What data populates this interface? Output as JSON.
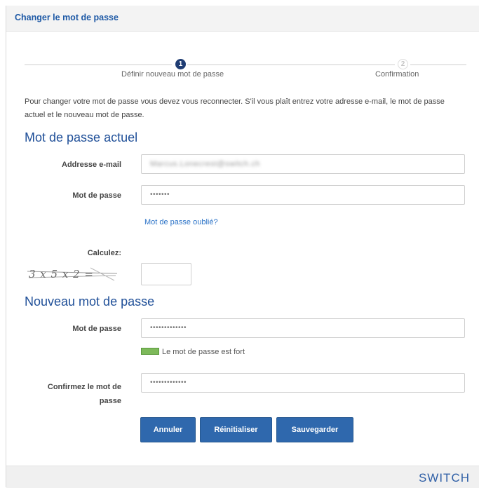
{
  "header": {
    "title": "Changer le mot de passe"
  },
  "steps": [
    {
      "number": "1",
      "label": "Définir nouveau mot de passe",
      "active": true
    },
    {
      "number": "2",
      "label": "Confirmation",
      "active": false
    }
  ],
  "intro": "Pour changer votre mot de passe vous devez vous reconnecter. S'il vous plaît entrez votre adresse e-mail, le mot de passe actuel et le nouveau mot de passe.",
  "current_section": {
    "title": "Mot de passe actuel",
    "email_label": "Addresse e-mail",
    "email_value": "Marcus.Lonecrest@switch.ch",
    "password_label": "Mot de passe",
    "password_value": "•••••••",
    "forgot_link": "Mot de passe oublié?",
    "captcha_label": "Calculez:",
    "captcha_text": "3 x 5 x 2 =",
    "captcha_value": ""
  },
  "new_section": {
    "title": "Nouveau mot de passe",
    "password_label": "Mot de passe",
    "password_value": "•••••••••••••",
    "strength_text": "Le mot de passe est fort",
    "confirm_label_line1": "Confirmez le mot de",
    "confirm_label_line2": "passe",
    "confirm_value": "•••••••••••••"
  },
  "buttons": {
    "cancel": "Annuler",
    "reset": "Réinitialiser",
    "save": "Sauvegarder"
  },
  "footer": {
    "logo": "SWITCH"
  },
  "colors": {
    "accent": "#1f4f98",
    "button": "#2f68ad",
    "strength": "#7db95a"
  }
}
